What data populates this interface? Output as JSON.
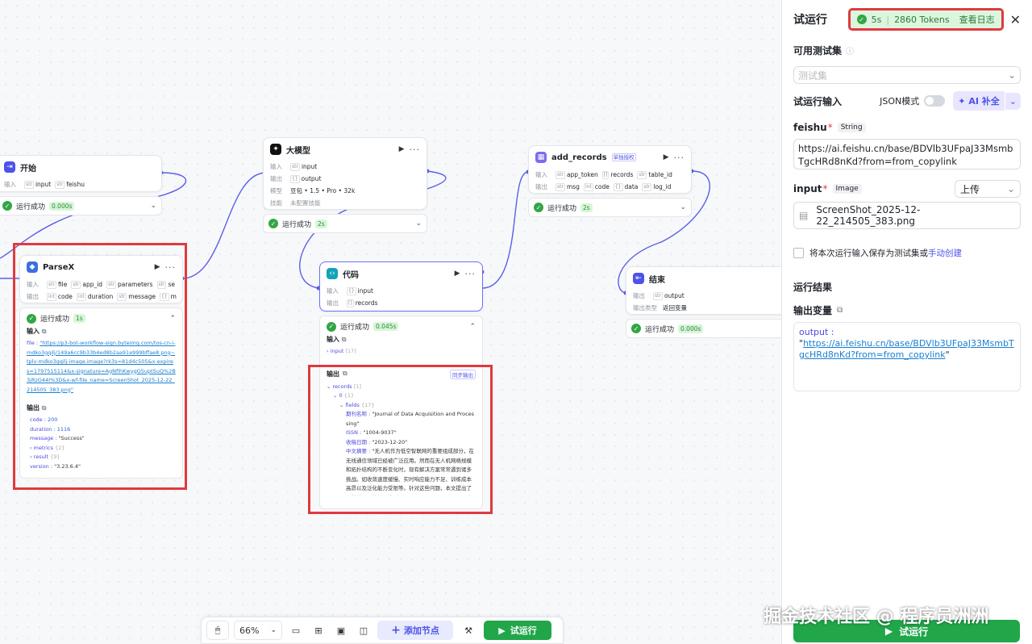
{
  "canvas": {
    "start": {
      "title": "开始",
      "input_label": "输入",
      "vars": [
        {
          "t": "str",
          "n": "input"
        },
        {
          "t": "str",
          "n": "feishu"
        }
      ],
      "status": "运行成功",
      "time": "0.000s"
    },
    "llm": {
      "title": "大模型",
      "in_label": "输入",
      "in_var": "input",
      "out_label": "输出",
      "out_var": "output",
      "model_label": "模型",
      "model": "豆包 • 1.5 • Pro • 32k",
      "skill_label": "技能",
      "skill": "未配置技能",
      "status": "运行成功",
      "time": "2s"
    },
    "parsex": {
      "title": "ParseX",
      "in_label": "输入",
      "in_vars": [
        "file",
        "app_id",
        "parameters",
        "se"
      ],
      "out_label": "输出",
      "out_vars": [
        "code",
        "duration",
        "message",
        "m"
      ],
      "status": "运行成功",
      "time": "1s",
      "input_sec": "输入",
      "file_key": "file :",
      "file_val": "\"https://p3-bot-workflow-sign.byteimg.com/tos-cn-i-mdko3gqilj/149a6cc9b33b4ed8b2aa91e999bffae8.png~tplv-mdko3gqilj-image.image?rk3s=81d4c505&x-expires=1797515114&x-signature=AgNfihKwygG5uptSuQ%2B3jRzG44I%3D&x-wf-file_name=ScreenShot_2025-12-22_214505_383.png\"",
      "output_sec": "输出",
      "code_k": "code :",
      "code_v": "200",
      "dur_k": "duration :",
      "dur_v": "1116",
      "msg_k": "message :",
      "msg_v": "\"Success\"",
      "metrics": "› metrics",
      "metrics_n": "{2}",
      "result": "› result",
      "result_n": "{9}",
      "ver_k": "version :",
      "ver_v": "\"3.23.6.4\""
    },
    "code": {
      "title": "代码",
      "in_label": "输入",
      "in_var": "input",
      "out_label": "输出",
      "out_var": "records",
      "status": "运行成功",
      "time": "0.045s",
      "input_sec": "输入",
      "input_row": "› input",
      "input_n": "[17]",
      "output_sec": "输出",
      "sync": "同步输出",
      "rec": "⌄ records",
      "rec_n": "[1]",
      "zero": "⌄ 0",
      "zero_n": "{1}",
      "fields": "⌄ fields",
      "fields_n": "{17}",
      "f1k": "期刊名称 :",
      "f1v": "\"Journal of Data Acquisition and Processing\"",
      "f2k": "ISSN :",
      "f2v": "\"1004-9037\"",
      "f3k": "收稿日期 :",
      "f3v": "\"2023-12-20\"",
      "f4k": "中文摘要 :",
      "f4v": "\"无人机作为低空智联网的重要组成部分，在无线通信领域已经被广泛应用。然而在无人机网络规模和拓扑结构的不断变化时，现有解决方案常常遇到诸多挑战。如收敛速度缓慢、实时响应能力不足、训练成本高昂以及泛化能力受限等。针对这些问题，本文提出了一种基于图神经网络（Graph neural network,GNN）的无人机网络观测表征和决策方案。研究首先通过图建模方法对无人"
    },
    "add": {
      "title": "add_records",
      "badge": "单独授权",
      "in_label": "输入",
      "in_vars": [
        "app_token",
        "records",
        "table_id"
      ],
      "out_label": "输出",
      "out_vars": [
        "msg",
        "code",
        "data",
        "log_id"
      ],
      "status": "运行成功",
      "time": "2s"
    },
    "end": {
      "title": "结束",
      "out_label": "输出",
      "out_var": "output",
      "ret_label": "输出类型",
      "ret": "返回变量",
      "status": "运行成功",
      "time": "0.000s"
    }
  },
  "toolbar": {
    "zoom": "66%",
    "add_node": "添加节点",
    "run": "试运行"
  },
  "panel": {
    "title": "试运行",
    "time": "5s",
    "tokens": "2860 Tokens",
    "log": "查看日志",
    "testset_label": "可用测试集",
    "testset_placeholder": "测试集",
    "input_label": "试运行输入",
    "json_mode": "JSON模式",
    "ai_fill": "AI 补全",
    "feishu_label": "feishu",
    "feishu_type": "String",
    "feishu_value": "https://ai.feishu.cn/base/BDVlb3UFpaJ33MsmbTgcHRd8nKd?from=from_copylink",
    "image_label": "input",
    "image_type": "Image",
    "upload": "上传",
    "file_name": "ScreenShot_2025-12-22_214505_383.png",
    "save_text": "将本次运行输入保存为测试集或",
    "save_link": "手动创建",
    "result_label": "运行结果",
    "outvar_label": "输出变量",
    "out_key": "output :",
    "out_link": "https://ai.feishu.cn/base/BDVlb3UFpaJ33MsmbTgcHRd8nKd?from=from_copylink",
    "run_button": "试运行"
  },
  "watermark": "掘金技术社区 @ 程序员洲洲",
  "colors": {
    "accent": "#4d53e8",
    "success": "#32a645",
    "highlight": "#e03a3e"
  }
}
